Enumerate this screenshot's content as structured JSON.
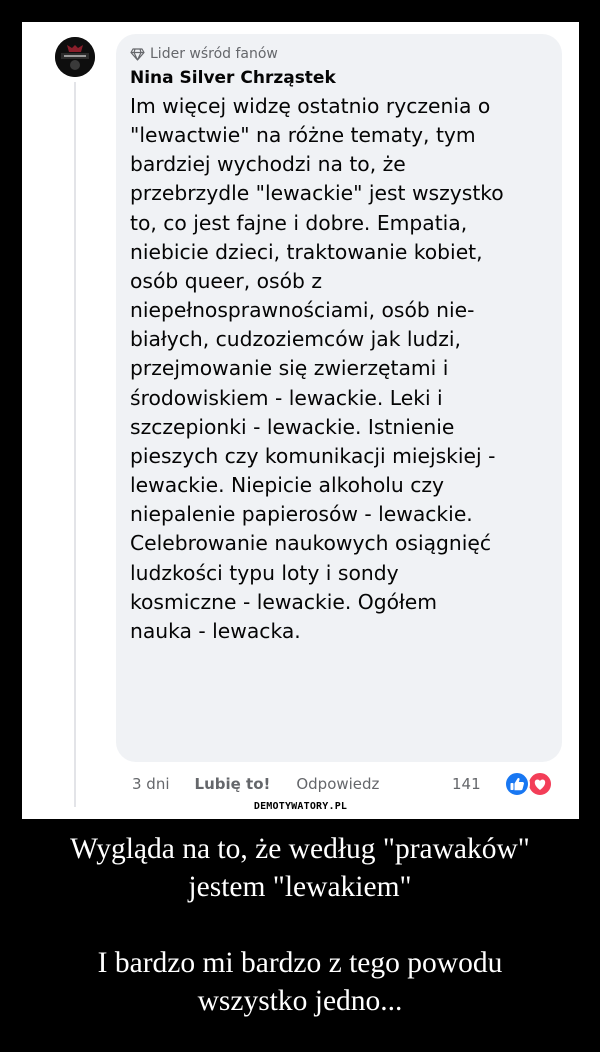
{
  "post": {
    "badge": "Lider wśród fanów",
    "author": "Nina Silver Chrząstek",
    "comment_lines": [
      "Im więcej widzę ostatnio ryczenia o",
      "\"lewactwie\" na różne tematy, tym",
      "bardziej wychodzi na to, że",
      "przebrzydle \"lewackie\" jest wszystko",
      "to, co jest fajne i dobre. Empatia,",
      "niebicie dzieci, traktowanie kobiet,",
      "osób queer, osób z",
      "niepełnosprawnościami, osób nie-",
      "białych, cudzoziemców jak ludzi,",
      "przejmowanie się zwierzętami i",
      "środowiskiem - lewackie. Leki i",
      "szczepionki - lewackie. Istnienie",
      "pieszych czy komunikacji miejskiej -",
      "lewackie. Niepicie alkoholu czy",
      "niepalenie papierosów - lewackie.",
      "Celebrowanie naukowych osiągnięć",
      "ludzkości typu loty i sondy",
      "kosmiczne - lewackie. Ogółem",
      "nauka - lewacka."
    ],
    "time": "3 dni",
    "like_label": "Lubię to!",
    "reply_label": "Odpowiedz",
    "reaction_count": "141",
    "reactions": [
      "like-icon",
      "love-icon"
    ]
  },
  "watermark": "DEMOTYWATORY.PL",
  "caption": {
    "line1": "Wygląda na to, że według \"prawaków\"",
    "line2": "jestem \"lewakiem\"",
    "line3": "I bardzo mi bardzo z tego powodu",
    "line4": "wszystko jedno..."
  },
  "colors": {
    "bubble": "#f0f2f5",
    "like_blue": "#1877f2",
    "love_red": "#f33e58",
    "meta_grey": "#65676b"
  }
}
